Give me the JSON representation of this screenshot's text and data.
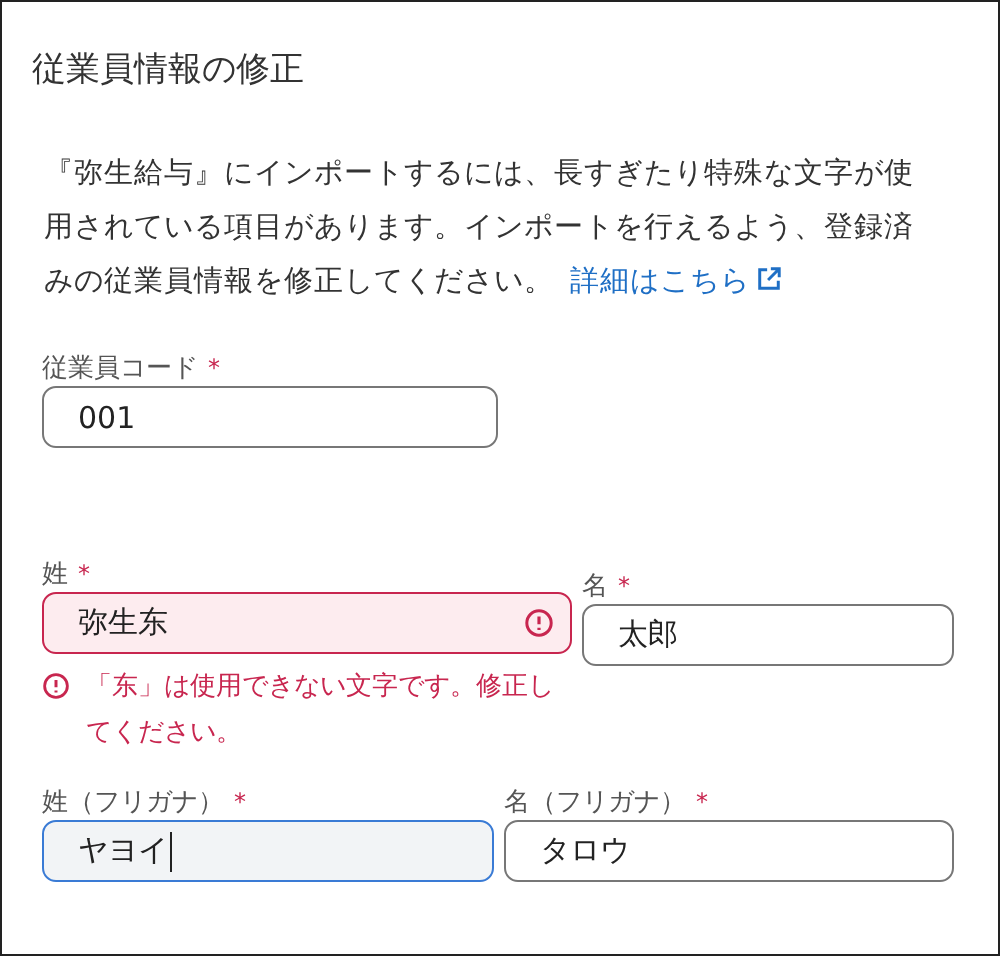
{
  "title": "従業員情報の修正",
  "notice": {
    "text": "『弥生給与』にインポートするには、長すぎたり特殊な文字が使用されている項目があります。インポートを行えるよう、登録済みの従業員情報を修正してください。",
    "link": "詳細はこちら"
  },
  "rows": [
    {
      "fields": [
        {
          "label": "従業員コード",
          "required_mark": "*",
          "value": "001",
          "invalid": false,
          "focused": false
        }
      ]
    },
    {
      "fields": [
        {
          "label": "姓",
          "required_mark": "*",
          "value": "弥生东",
          "invalid": true,
          "focused": false,
          "error": "「东」は使用できない文字です。修正してください。"
        },
        {
          "label": "名",
          "required_mark": "*",
          "value": "太郎",
          "invalid": false,
          "focused": false
        }
      ]
    },
    {
      "fields": [
        {
          "label": "姓（フリガナ）",
          "required_mark": "*",
          "value": "ヤヨイ",
          "invalid": false,
          "focused": true
        },
        {
          "label": "名（フリガナ）",
          "required_mark": "*",
          "value": "タロウ",
          "invalid": false,
          "focused": false
        }
      ]
    }
  ]
}
